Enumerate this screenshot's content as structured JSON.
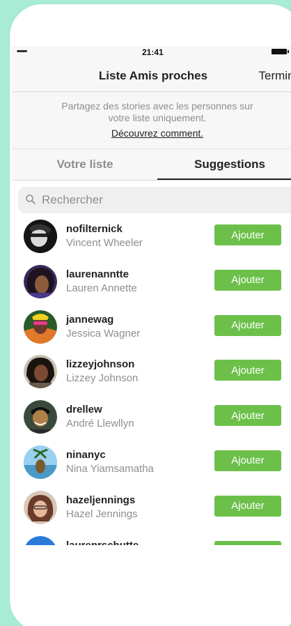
{
  "status_bar": {
    "signal": "•••••",
    "time": "21:41"
  },
  "nav": {
    "title": "Liste Amis proches",
    "done_label": "Terminé"
  },
  "info": {
    "description": "Partagez des stories avec les personnes sur votre liste uniquement.",
    "learn_more": "Découvrez comment."
  },
  "tabs": [
    {
      "label": "Votre liste",
      "active": false
    },
    {
      "label": "Suggestions",
      "active": true
    }
  ],
  "search": {
    "placeholder": "Rechercher"
  },
  "add_label": "Ajouter",
  "users": [
    {
      "username": "nofilternick",
      "name": "Vincent Wheeler",
      "avatar_color": "#1a1a1a"
    },
    {
      "username": "laurenanntte",
      "name": "Lauren Annette",
      "avatar_color": "#3a2a5a"
    },
    {
      "username": "jannewag",
      "name": "Jessica Wagner",
      "avatar_color": "#e07a2a"
    },
    {
      "username": "lizzeyjohnson",
      "name": "Lizzey Johnson",
      "avatar_color": "#6a4a3a"
    },
    {
      "username": "drellew",
      "name": "André Llewllyn",
      "avatar_color": "#2a3a2a"
    },
    {
      "username": "ninanyc",
      "name": "Nina Yiamsamatha",
      "avatar_color": "#7ab8d8"
    },
    {
      "username": "hazeljennings",
      "name": "Hazel Jennings",
      "avatar_color": "#8a5a4a"
    },
    {
      "username": "laurenrschutte",
      "name": "",
      "avatar_color": "#2a7ad8"
    }
  ],
  "colors": {
    "background": "#a8ecd6",
    "accent": "#6cc04a"
  }
}
